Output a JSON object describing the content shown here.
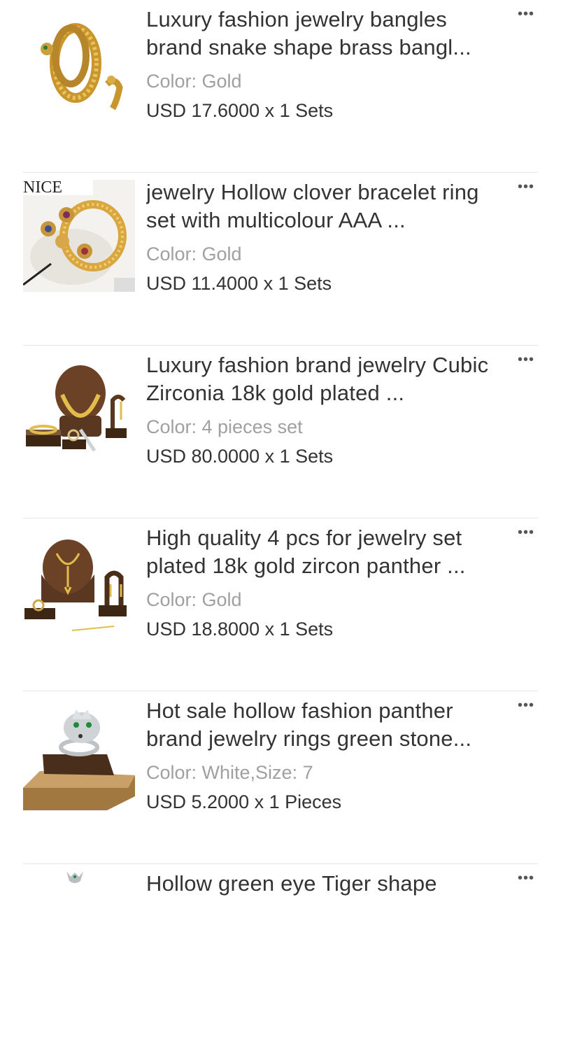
{
  "items": [
    {
      "title": "Luxury fashion jewelry bangles brand snake shape brass bangl...",
      "color": "Color: Gold",
      "price": "USD 17.6000 x 1 Sets",
      "image": "snake-bangle-ring-image"
    },
    {
      "title": "jewelry Hollow clover bracelet ring set with multicolour AAA ...",
      "color": "Color: Gold",
      "price": "USD 11.4000 x 1 Sets",
      "image": "clover-bracelet-ring-image"
    },
    {
      "title": "Luxury  fashion brand jewelry Cubic Zirconia  18k gold plated ...",
      "color": "Color: 4 pieces set",
      "price": "USD 80.0000 x 1 Sets",
      "image": "gold-necklace-set-image"
    },
    {
      "title": "High quality 4 pcs for jewelry set plated 18k gold zircon panther ...",
      "color": "Color: Gold",
      "price": "USD 18.8000 x 1 Sets",
      "image": "panther-jewelry-set-image"
    },
    {
      "title": "Hot sale hollow fashion panther brand jewelry rings green stone...",
      "color": "Color: White,Size: 7",
      "price": "USD 5.2000 x 1 Pieces",
      "image": "panther-ring-image"
    },
    {
      "title": "Hollow green eye Tiger shape",
      "image": "tiger-ring-image"
    }
  ],
  "more_label": "•••"
}
